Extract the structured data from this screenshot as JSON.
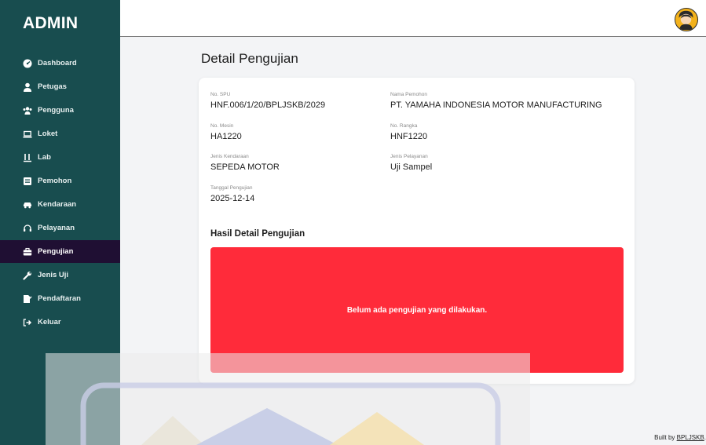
{
  "sidebar": {
    "brand": "ADMIN",
    "items": [
      {
        "label": "Dashboard",
        "icon": "dashboard-icon",
        "active": false
      },
      {
        "label": "Petugas",
        "icon": "user-tie-icon",
        "active": false
      },
      {
        "label": "Pengguna",
        "icon": "users-icon",
        "active": false
      },
      {
        "label": "Loket",
        "icon": "laptop-icon",
        "active": false
      },
      {
        "label": "Lab",
        "icon": "flask-icon",
        "active": false
      },
      {
        "label": "Pemohon",
        "icon": "id-card-icon",
        "active": false
      },
      {
        "label": "Kendaraan",
        "icon": "car-icon",
        "active": false
      },
      {
        "label": "Pelayanan",
        "icon": "headset-icon",
        "active": false
      },
      {
        "label": "Pengujian",
        "icon": "briefcase-icon",
        "active": true
      },
      {
        "label": "Jenis Uji",
        "icon": "wrench-icon",
        "active": false
      },
      {
        "label": "Pendaftaran",
        "icon": "file-signature-icon",
        "active": false
      },
      {
        "label": "Keluar",
        "icon": "sign-out-icon",
        "active": false
      }
    ]
  },
  "page": {
    "title": "Detail Pengujian"
  },
  "details": {
    "no_spu": {
      "label": "No. SPU",
      "value": "HNF.006/1/20/BPLJSKB/2029"
    },
    "nama_pemohon": {
      "label": "Nama Pemohon",
      "value": "PT. YAMAHA INDONESIA MOTOR MANUFACTURING"
    },
    "no_mesin": {
      "label": "No. Mesin",
      "value": "HA1220"
    },
    "no_rangka": {
      "label": "No. Rangka",
      "value": "HNF1220"
    },
    "jenis_kendaraan": {
      "label": "Jenis Kendaraan",
      "value": "SEPEDA MOTOR"
    },
    "jenis_pelayanan": {
      "label": "Jenis Pelayanan",
      "value": "Uji Sampel"
    },
    "tanggal_pengujian": {
      "label": "Tanggal Pengujian",
      "value": "2025-12-14"
    }
  },
  "hasil": {
    "title": "Hasil Detail Pengujian",
    "empty_message": "Belum ada pengujian yang dilakukan."
  },
  "footer": {
    "prefix": "Built by ",
    "link": "BPLJSKB",
    "suffix": "."
  },
  "colors": {
    "sidebar": "#184d4f",
    "active": "#1f0f33",
    "alert": "#ff2b3a",
    "avatar": "#f3b21c"
  }
}
